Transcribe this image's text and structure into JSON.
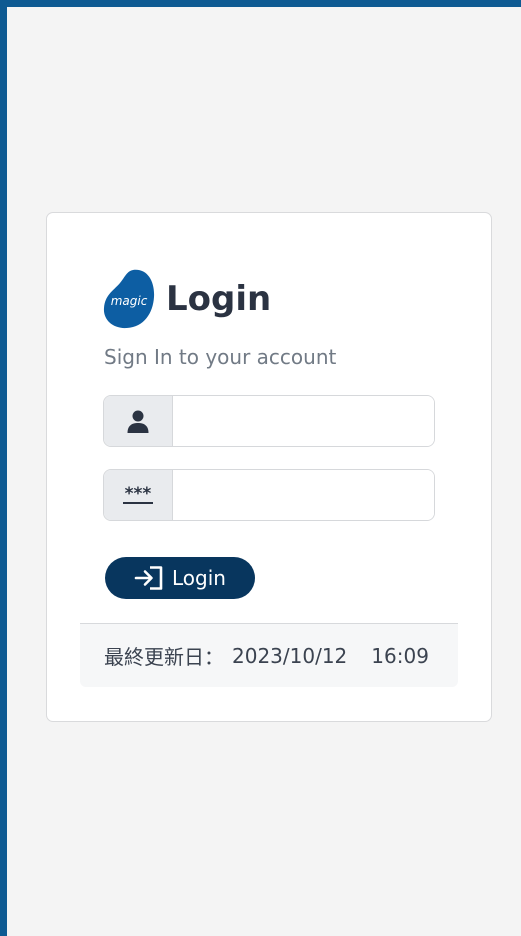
{
  "header": {
    "logo_text": "magic",
    "title": "Login",
    "subtitle": "Sign In to your account"
  },
  "form": {
    "username": {
      "value": "",
      "placeholder": "",
      "icon": "user-icon"
    },
    "password": {
      "value": "",
      "placeholder": "",
      "icon": "password-asterisk-icon",
      "icon_text": "***"
    },
    "submit_label": "Login",
    "submit_icon": "sign-in-icon"
  },
  "footer": {
    "label": "最終更新日：",
    "date": "2023/10/12",
    "time": "16:09"
  },
  "colors": {
    "frame": "#0e5a92",
    "background": "#f4f4f4",
    "brand": "#0d5ea3",
    "button": "#08365e",
    "title": "#2b3342",
    "subtitle": "#717a85"
  }
}
